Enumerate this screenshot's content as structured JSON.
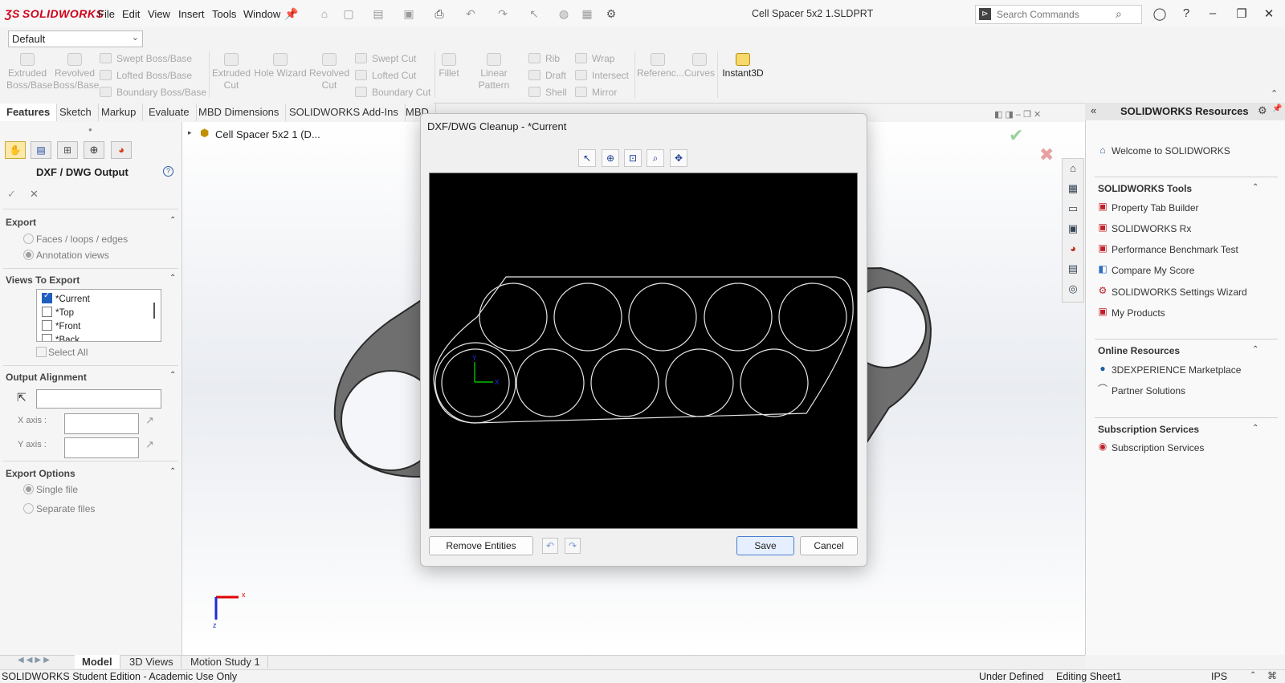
{
  "app": {
    "logo": "SOLIDWORKS",
    "title": "Cell Spacer 5x2 1.SLDPRT",
    "menu": [
      "File",
      "Edit",
      "View",
      "Insert",
      "Tools",
      "Window"
    ],
    "search_placeholder": "Search Commands"
  },
  "config": {
    "selected": "Default"
  },
  "ribbon": {
    "extruded_boss": "Extruded Boss/Base",
    "revolved_boss": "Revolved Boss/Base",
    "swept_boss": "Swept Boss/Base",
    "lofted_boss": "Lofted Boss/Base",
    "boundary_boss": "Boundary Boss/Base",
    "extruded_cut": "Extruded Cut",
    "hole_wizard": "Hole Wizard",
    "revolved_cut": "Revolved Cut",
    "swept_cut": "Swept Cut",
    "lofted_cut": "Lofted Cut",
    "boundary_cut": "Boundary Cut",
    "fillet": "Fillet",
    "linear_pattern": "Linear Pattern",
    "rib": "Rib",
    "draft": "Draft",
    "shell": "Shell",
    "wrap": "Wrap",
    "intersect": "Intersect",
    "mirror": "Mirror",
    "reference": "Referenc...",
    "curves": "Curves",
    "instant3d": "Instant3D"
  },
  "cmd_tabs": [
    "Features",
    "Sketch",
    "Markup",
    "Evaluate",
    "MBD Dimensions",
    "SOLIDWORKS Add-Ins",
    "MBD"
  ],
  "panel": {
    "title": "DXF / DWG Output",
    "export": {
      "header": "Export",
      "options": [
        "Faces / loops / edges",
        "Annotation views"
      ]
    },
    "views": {
      "header": "Views To Export",
      "items": [
        "*Current",
        "*Top",
        "*Front",
        "*Back"
      ],
      "select_all": "Select All"
    },
    "alignment": {
      "header": "Output Alignment",
      "x_axis": "X axis :",
      "y_axis": "Y axis :"
    },
    "export_options": {
      "header": "Export Options",
      "options": [
        "Single file",
        "Separate files"
      ]
    }
  },
  "tree": {
    "root": "Cell Spacer 5x2 1 (D..."
  },
  "dialog": {
    "title": "DXF/DWG Cleanup - *Current",
    "remove_entities": "Remove Entities",
    "save": "Save",
    "cancel": "Cancel"
  },
  "task_pane": {
    "title": "SOLIDWORKS Resources",
    "welcome": "Welcome to SOLIDWORKS",
    "tools": {
      "header": "SOLIDWORKS Tools",
      "items": [
        "Property Tab Builder",
        "SOLIDWORKS Rx",
        "Performance Benchmark Test",
        "Compare My Score",
        "SOLIDWORKS Settings Wizard",
        "My Products"
      ]
    },
    "online": {
      "header": "Online Resources",
      "items": [
        "3DEXPERIENCE Marketplace",
        "Partner Solutions"
      ]
    },
    "subscription": {
      "header": "Subscription Services",
      "items": [
        "Subscription Services"
      ]
    }
  },
  "bottom_tabs": [
    "Model",
    "3D Views",
    "Motion Study 1"
  ],
  "status": {
    "edition": "SOLIDWORKS Student Edition - Academic Use Only",
    "defined": "Under Defined",
    "editing": "Editing Sheet1",
    "units": "IPS"
  },
  "colors": {
    "accent": "#d0021b",
    "canvas": "#000000",
    "triad_x": "#e00000",
    "triad_y": "#00b000",
    "triad_z": "#1f2ad6"
  }
}
